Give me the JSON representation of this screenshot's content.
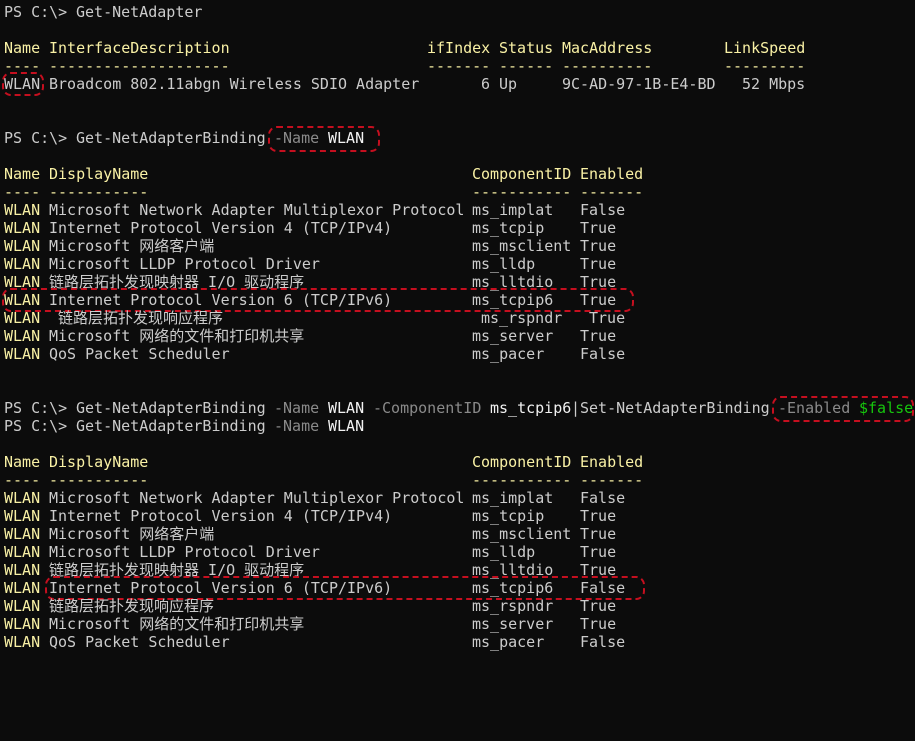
{
  "prompt": "PS C:\\>",
  "colors": {
    "background": "#0c0c0c",
    "text": "#cccccc",
    "header": "#f9f1a5",
    "parameter": "#8a8a8a",
    "variable": "#16c60c",
    "highlight": "#c50f1f"
  },
  "block1": {
    "command": "Get-NetAdapter",
    "headers": [
      "Name",
      "InterfaceDescription",
      "ifIndex",
      "Status",
      "MacAddress",
      "LinkSpeed"
    ],
    "separators": [
      "----",
      "--------------------",
      "-------",
      "------",
      "----------",
      "---------"
    ],
    "row": {
      "name": "WLAN",
      "description": "Broadcom 802.11abgn Wireless SDIO Adapter",
      "ifindex": "6",
      "status": "Up",
      "mac": "9C-AD-97-1B-E4-BD",
      "speed": "52 Mbps"
    }
  },
  "block2": {
    "command": "Get-NetAdapterBinding",
    "param": "-Name",
    "value": "WLAN",
    "headers": [
      "Name",
      "DisplayName",
      "ComponentID",
      "Enabled"
    ],
    "separators": [
      "----",
      "-----------",
      "-----------",
      "-------"
    ],
    "rows": [
      {
        "name": "WLAN",
        "display": "Microsoft Network Adapter Multiplexor Protocol",
        "cid": "ms_implat",
        "enabled": "False"
      },
      {
        "name": "WLAN",
        "display": "Internet Protocol Version 4 (TCP/IPv4)",
        "cid": "ms_tcpip",
        "enabled": "True"
      },
      {
        "name": "WLAN",
        "display": "Microsoft 网络客户端",
        "cid": "ms_msclient",
        "enabled": "True"
      },
      {
        "name": "WLAN",
        "display": "Microsoft LLDP Protocol Driver",
        "cid": "ms_lldp",
        "enabled": "True"
      },
      {
        "name": "WLAN",
        "display": "链路层拓扑发现映射器 I/O 驱动程序",
        "cid": "ms_lltdio",
        "enabled": "True"
      },
      {
        "name": "WLAN",
        "display": "Internet Protocol Version 6 (TCP/IPv6)",
        "cid": "ms_tcpip6",
        "enabled": "True"
      },
      {
        "name": "WLAN",
        "display": "链路层拓扑发现响应程序",
        "cid": "ms_rspndr",
        "enabled": "True"
      },
      {
        "name": "WLAN",
        "display": "Microsoft 网络的文件和打印机共享",
        "cid": "ms_server",
        "enabled": "True"
      },
      {
        "name": "WLAN",
        "display": "QoS Packet Scheduler",
        "cid": "ms_pacer",
        "enabled": "False"
      }
    ]
  },
  "block3": {
    "command": "Get-NetAdapterBinding",
    "param_name": "-Name",
    "value_name": "WLAN",
    "param_cid": "-ComponentID",
    "value_cid": "ms_tcpip6",
    "pipe": "|",
    "command2": "Set-NetAdapterBinding",
    "param_enabled": "-Enabled",
    "value_enabled": "$false"
  },
  "block4": {
    "command": "Get-NetAdapterBinding",
    "param": "-Name",
    "value": "WLAN",
    "headers": [
      "Name",
      "DisplayName",
      "ComponentID",
      "Enabled"
    ],
    "separators": [
      "----",
      "-----------",
      "-----------",
      "-------"
    ],
    "rows": [
      {
        "name": "WLAN",
        "display": "Microsoft Network Adapter Multiplexor Protocol",
        "cid": "ms_implat",
        "enabled": "False"
      },
      {
        "name": "WLAN",
        "display": "Internet Protocol Version 4 (TCP/IPv4)",
        "cid": "ms_tcpip",
        "enabled": "True"
      },
      {
        "name": "WLAN",
        "display": "Microsoft 网络客户端",
        "cid": "ms_msclient",
        "enabled": "True"
      },
      {
        "name": "WLAN",
        "display": "Microsoft LLDP Protocol Driver",
        "cid": "ms_lldp",
        "enabled": "True"
      },
      {
        "name": "WLAN",
        "display": "链路层拓扑发现映射器 I/O 驱动程序",
        "cid": "ms_lltdio",
        "enabled": "True"
      },
      {
        "name": "WLAN",
        "display": "Internet Protocol Version 6 (TCP/IPv6)",
        "cid": "ms_tcpip6",
        "enabled": "False"
      },
      {
        "name": "WLAN",
        "display": "链路层拓扑发现响应程序",
        "cid": "ms_rspndr",
        "enabled": "True"
      },
      {
        "name": "WLAN",
        "display": "Microsoft 网络的文件和打印机共享",
        "cid": "ms_server",
        "enabled": "True"
      },
      {
        "name": "WLAN",
        "display": "QoS Packet Scheduler",
        "cid": "ms_pacer",
        "enabled": "False"
      }
    ]
  }
}
